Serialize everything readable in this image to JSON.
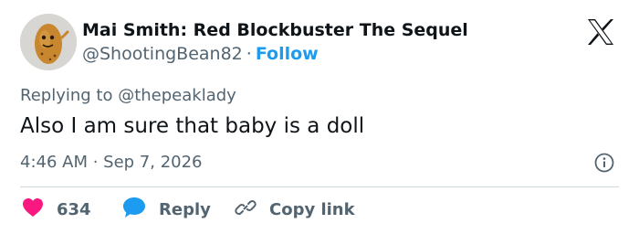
{
  "author": {
    "display_name": "Mai Smith: Red Blockbuster The Sequel",
    "handle": "@ShootingBean82",
    "separator": "·",
    "follow_label": "Follow"
  },
  "replying": {
    "prefix": "Replying to ",
    "mention": "@thepeaklady"
  },
  "tweet": {
    "text": "Also I am sure that baby is a doll",
    "timestamp": "4:46 AM · Sep 7, 2026"
  },
  "actions": {
    "like_count": "634",
    "reply_label": "Reply",
    "copy_link_label": "Copy link"
  },
  "icons": {
    "avatar": "bean-character-avatar",
    "logo": "x-logo-icon",
    "info": "info-icon",
    "like": "heart-icon",
    "reply": "speech-bubble-icon",
    "copy": "link-icon"
  },
  "colors": {
    "accent": "#1d9bf0",
    "like": "#f91880",
    "text": "#0f1419",
    "muted": "#536471",
    "divider": "#cfd9de"
  }
}
